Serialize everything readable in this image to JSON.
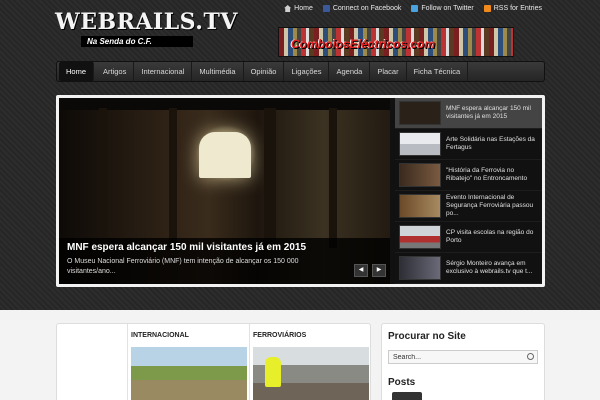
{
  "header": {
    "logo_title": "WEBRAILS.TV",
    "logo_subtitle": "Na Senda do C.F.",
    "banner_text": "ComboiosEléctricos.com",
    "top_links": [
      {
        "label": "Home",
        "icon": "home-icon"
      },
      {
        "label": "Connect on Facebook",
        "icon": "facebook-icon"
      },
      {
        "label": "Follow on Twitter",
        "icon": "twitter-icon"
      },
      {
        "label": "RSS for Entries",
        "icon": "rss-icon"
      }
    ]
  },
  "nav": {
    "items": [
      "Home",
      "Artigos",
      "Internacional",
      "Multimédia",
      "Opinião",
      "Ligações",
      "Agenda",
      "Placar",
      "Ficha Técnica"
    ]
  },
  "slider": {
    "title": "MNF espera alcançar 150 mil visitantes já em 2015",
    "excerpt": "O Museu Nacional Ferroviário (MNF) tem intenção de alcançar os 150 000 visitantes/ano...",
    "prev_glyph": "◀",
    "next_glyph": "▶",
    "items": [
      {
        "title": "MNF espera alcançar 150 mil visitantes já em 2015",
        "thumb": "#2a2218"
      },
      {
        "title": "Arte Solidária nas Estações da Fertagus",
        "thumb": "#d9dde2"
      },
      {
        "title": "\"História da Ferrovia no Ribatejo\" no Entroncamento",
        "thumb": "#5a4030"
      },
      {
        "title": "Evento Internacional de Segurança Ferroviária passou po...",
        "thumb": "#8a6a40"
      },
      {
        "title": "CP visita escolas na região do Porto",
        "thumb": "#b03030"
      },
      {
        "title": "Sérgio Monteiro avança em exclusivo à webrails.tv que t...",
        "thumb": "#4a4a55"
      }
    ]
  },
  "content": {
    "categories": [
      {
        "title": "INTERNACIONAL"
      },
      {
        "title": "FERROVIÁRIOS"
      }
    ]
  },
  "sidebar": {
    "search_title": "Procurar no Site",
    "search_value": "Search...",
    "posts_title": "Posts"
  }
}
